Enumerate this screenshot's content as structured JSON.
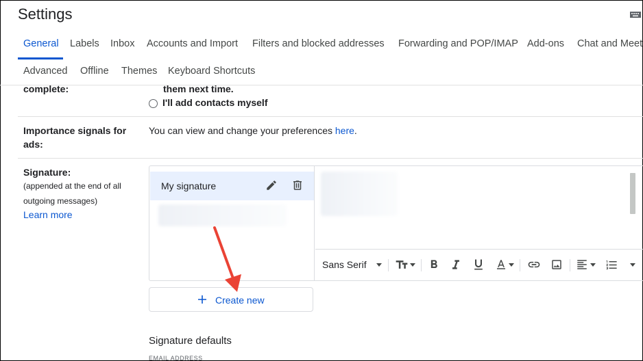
{
  "header": {
    "title": "Settings"
  },
  "tabs_row1": [
    "General",
    "Labels",
    "Inbox",
    "Accounts and Import",
    "Filters and blocked addresses",
    "Forwarding and POP/IMAP",
    "Add-ons",
    "Chat and Meet"
  ],
  "tabs_row2": [
    "Advanced",
    "Offline",
    "Themes",
    "Keyboard Shortcuts"
  ],
  "autocomplete": {
    "label": "complete:",
    "text_above": "them next time.",
    "radio_label": "I'll add contacts myself"
  },
  "importance": {
    "label_line1": "Importance signals for",
    "label_line2": "ads:",
    "text": "You can view and change your preferences ",
    "link": "here",
    "after": "."
  },
  "signature": {
    "label": "Signature:",
    "desc_line1": "(appended at the end of all",
    "desc_line2": "outgoing messages)",
    "learn_more": "Learn more",
    "items": [
      {
        "name": "My signature"
      }
    ],
    "toolbar": {
      "font": "Sans Serif"
    },
    "create_new": "Create new",
    "defaults_heading": "Signature defaults",
    "email_address_label": "EMAIL ADDRESS"
  },
  "colors": {
    "accent": "#0b57d0",
    "annotation": "#ea4335",
    "selected": "#e8f0fe"
  }
}
